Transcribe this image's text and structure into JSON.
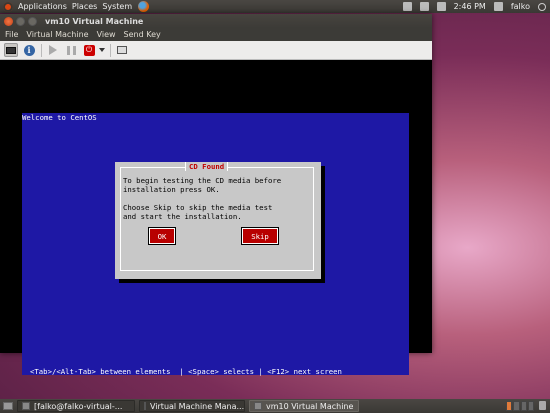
{
  "top_panel": {
    "menus": [
      "Applications",
      "Places",
      "System"
    ],
    "clock": "2:46 PM",
    "user": "falko"
  },
  "window": {
    "title": "vm10 Virtual Machine",
    "menu": [
      "File",
      "Virtual Machine",
      "View",
      "Send Key"
    ]
  },
  "guest": {
    "welcome": "Welcome to CentOS",
    "dialog": {
      "title": "CD Found",
      "text": "To begin testing the CD media before\ninstallation press OK.\n\nChoose Skip to skip the media test\nand start the installation.",
      "ok_label": "OK",
      "skip_label": "Skip"
    },
    "hint": "<Tab>/<Alt-Tab> between elements  | <Space> selects | <F12> next screen"
  },
  "taskbar": {
    "tasks": [
      {
        "label": "[falko@falko-virtual-...",
        "active": false
      },
      {
        "label": "Virtual Machine Mana...",
        "active": false
      },
      {
        "label": "vm10 Virtual Machine",
        "active": true
      }
    ]
  }
}
